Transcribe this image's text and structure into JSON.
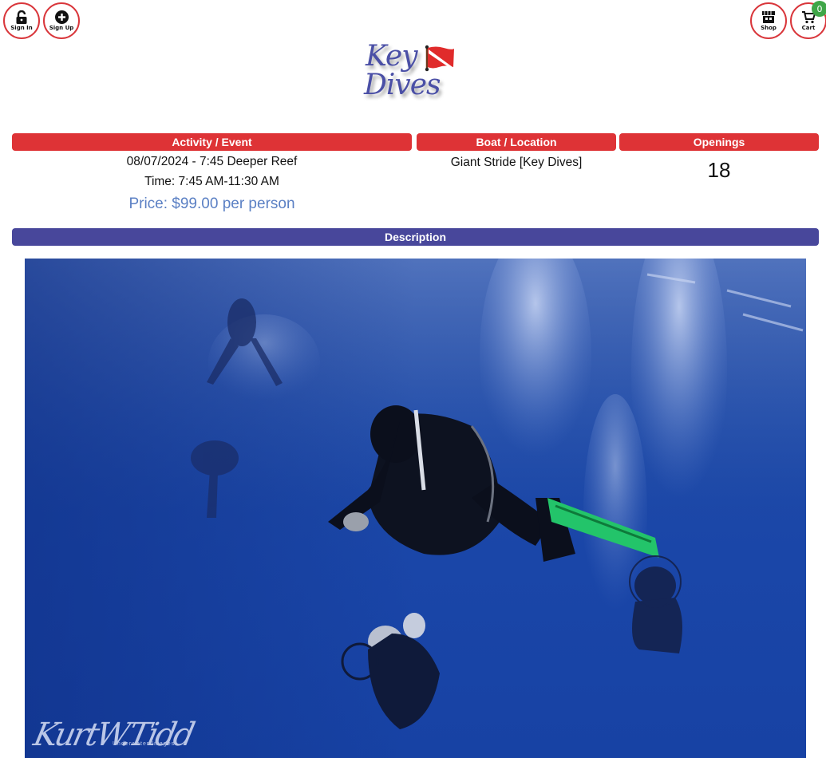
{
  "nav": {
    "sign_in": "Sign In",
    "sign_up": "Sign Up",
    "shop": "Shop",
    "cart": "Cart",
    "cart_count": "0"
  },
  "logo": {
    "line1": "Key",
    "line2": "Dives"
  },
  "event_table": {
    "headers": {
      "activity": "Activity / Event",
      "boat": "Boat / Location",
      "openings": "Openings"
    },
    "activity": {
      "title": "08/07/2024 - 7:45 Deeper Reef",
      "time": "Time: 7:45 AM-11:30 AM",
      "price": "Price: $99.00 per person"
    },
    "boat": "Giant Stride [Key Dives]",
    "openings": "18"
  },
  "description": {
    "header": "Description",
    "photo_alt": "Scuba divers descending in deep blue water",
    "watermark_name": "KurtW.Tidd",
    "watermark_sub": "Underwater Images"
  },
  "colors": {
    "header_red": "#de3336",
    "description_purple": "#48479b",
    "price_blue": "#5b80c4",
    "badge_green": "#3fa648"
  }
}
